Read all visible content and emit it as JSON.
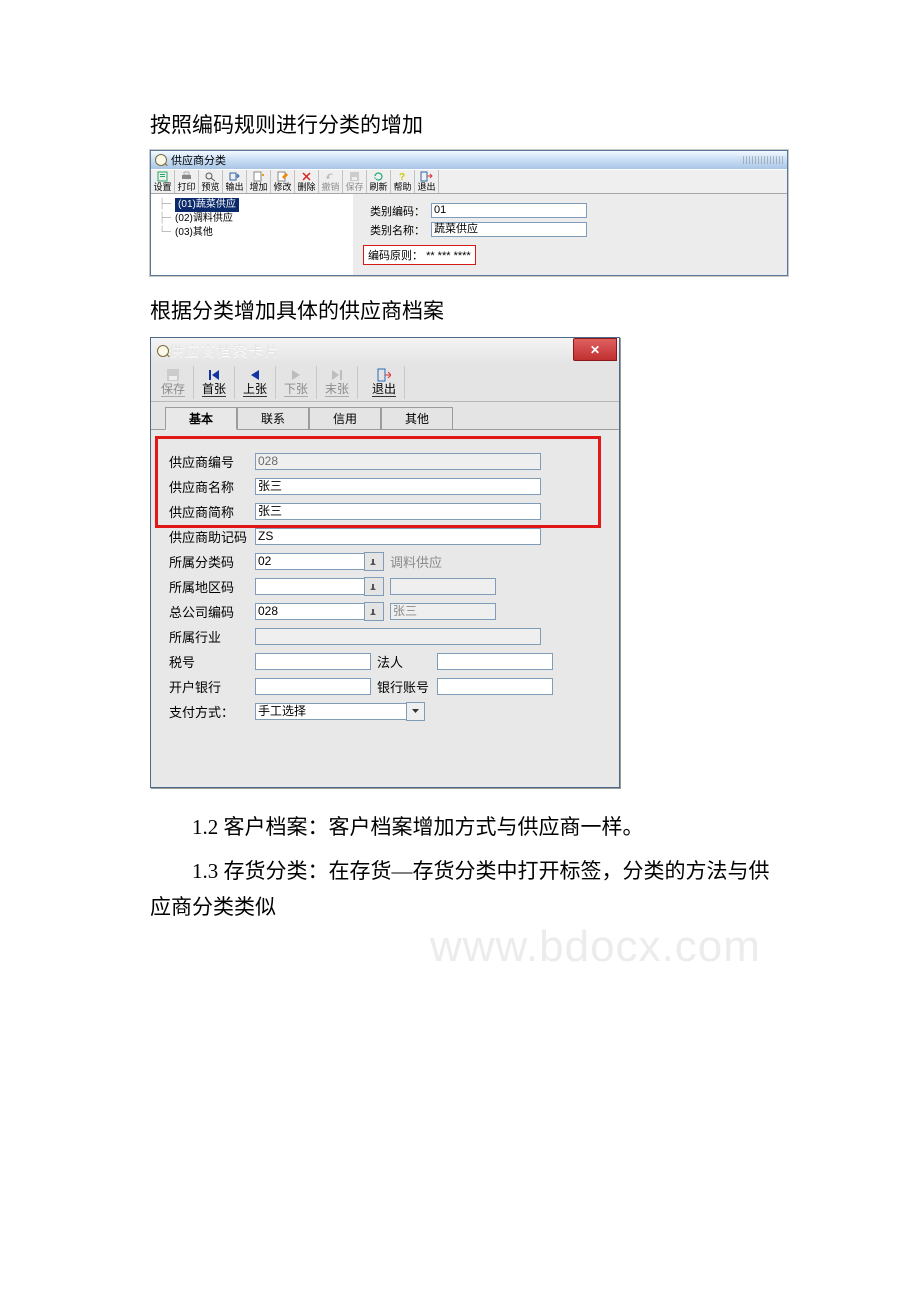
{
  "paragraphs": {
    "p1": "按照编码规则进行分类的增加",
    "p2": "根据分类增加具体的供应商档案",
    "p3": "1.2 客户档案：客户档案增加方式与供应商一样。",
    "p4": "1.3 存货分类：在存货—存货分类中打开标签，分类的方法与供应商分类类似"
  },
  "win1": {
    "title": "供应商分类",
    "toolbar": [
      {
        "name": "settings",
        "label": "设置"
      },
      {
        "name": "print",
        "label": "打印"
      },
      {
        "name": "preview",
        "label": "预览"
      },
      {
        "name": "export",
        "label": "输出"
      },
      {
        "name": "add",
        "label": "增加"
      },
      {
        "name": "edit",
        "label": "修改"
      },
      {
        "name": "delete",
        "label": "删除"
      },
      {
        "name": "undo",
        "label": "撤销",
        "disabled": true
      },
      {
        "name": "save",
        "label": "保存",
        "disabled": true
      },
      {
        "name": "refresh",
        "label": "刷新"
      },
      {
        "name": "help",
        "label": "帮助"
      },
      {
        "name": "exit",
        "label": "退出"
      }
    ],
    "tree": [
      {
        "code": "(01)",
        "label": "蔬菜供应",
        "selected": true
      },
      {
        "code": "(02)",
        "label": "调料供应"
      },
      {
        "code": "(03)",
        "label": "其他"
      }
    ],
    "fields": {
      "code_label": "类别编码：",
      "code_value": "01",
      "name_label": "类别名称：",
      "name_value": "蔬菜供应",
      "rule_label": "编码原则：",
      "rule_value": "** *** ****"
    }
  },
  "win2": {
    "title": "供应商档案卡片",
    "close": "✕",
    "nav": [
      {
        "name": "save",
        "label": "保存",
        "disabled": true
      },
      {
        "name": "first",
        "label": "首张"
      },
      {
        "name": "prev",
        "label": "上张"
      },
      {
        "name": "next",
        "label": "下张",
        "disabled": true
      },
      {
        "name": "last",
        "label": "末张",
        "disabled": true
      },
      {
        "name": "exit",
        "label": "退出"
      }
    ],
    "tabs": [
      {
        "name": "basic",
        "label": "基本",
        "active": true
      },
      {
        "name": "contact",
        "label": "联系"
      },
      {
        "name": "credit",
        "label": "信用"
      },
      {
        "name": "other",
        "label": "其他"
      }
    ],
    "form": {
      "supplier_code_label": "供应商编号",
      "supplier_code": "028",
      "supplier_name_label": "供应商名称",
      "supplier_name": "张三",
      "supplier_short_label": "供应商简称",
      "supplier_short": "张三",
      "supplier_mnemonic_label": "供应商助记码",
      "supplier_mnemonic": "ZS",
      "cat_code_label": "所属分类码",
      "cat_code": "02",
      "cat_name": "调料供应",
      "area_code_label": "所属地区码",
      "area_code": "",
      "area_name": "",
      "hq_code_label": "总公司编码",
      "hq_code": "028",
      "hq_name": "张三",
      "industry_label": "所属行业",
      "industry": "",
      "tax_label": "税号",
      "tax": "",
      "legal_label": "法人",
      "legal": "",
      "bank_label": "开户银行",
      "bank": "",
      "acct_label": "银行账号",
      "acct": "",
      "paymode_label": "支付方式：",
      "paymode": "手工选择"
    }
  },
  "watermark": "www.bdocx.com"
}
